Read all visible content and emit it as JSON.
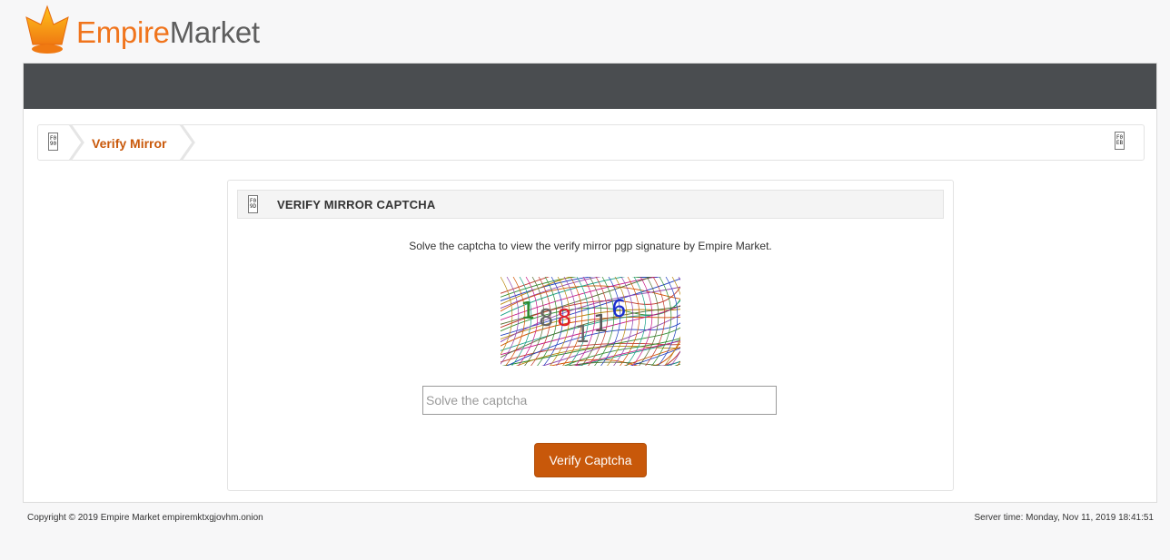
{
  "brand": {
    "logo_icon": "crown-icon",
    "name_part1": "Empire",
    "name_part2": "Market",
    "colors": {
      "orange": "#f0741c",
      "gray": "#5e5e5e",
      "accent": "#c8580a",
      "navbar": "#4a4d50"
    }
  },
  "breadcrumb": {
    "home_icon": "missing-glyph-icon",
    "current_label": "Verify Mirror",
    "right_icon": "missing-glyph-icon"
  },
  "panel": {
    "title": "VERIFY MIRROR CAPTCHA",
    "title_icon": "missing-glyph-icon",
    "description": "Solve the captcha to view the verify mirror pgp signature by Empire Market.",
    "captcha_text": "188116",
    "input": {
      "placeholder": "Solve the captcha",
      "value": ""
    },
    "submit_label": "Verify Captcha"
  },
  "footer": {
    "copyright": "Copyright © 2019 Empire Market empiremktxgjovhm.onion",
    "server_time": "Server time: Monday, Nov 11, 2019 18:41:51"
  }
}
